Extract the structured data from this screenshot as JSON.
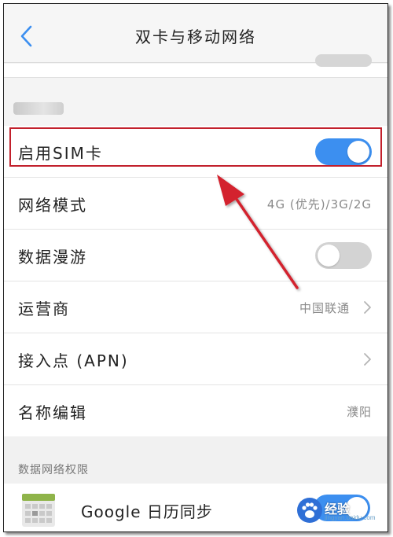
{
  "header": {
    "title": "双卡与移动网络",
    "back_icon": "chevron-left-icon"
  },
  "settings": [
    {
      "label": "启用SIM卡",
      "control": "toggle",
      "state": "on"
    },
    {
      "label": "网络模式",
      "value": "4G (优先)/3G/2G"
    },
    {
      "label": "数据漫游",
      "control": "toggle",
      "state": "off"
    },
    {
      "label": "运营商",
      "value": "中国联通",
      "chevron": true
    },
    {
      "label": "接入点 (APN)",
      "chevron": true
    },
    {
      "label": "名称编辑",
      "value": "濮阳"
    }
  ],
  "section": {
    "title": "数据网络权限"
  },
  "apps": [
    {
      "label": "Google 日历同步",
      "control": "toggle",
      "state": "on",
      "icon": "calendar-icon"
    }
  ],
  "watermark": {
    "text": "经验",
    "url": "jingyan.baidu.com"
  },
  "colors": {
    "accent": "#3c8ff0",
    "annotation": "#c2202c",
    "toggle_off": "#d3d3d3"
  }
}
